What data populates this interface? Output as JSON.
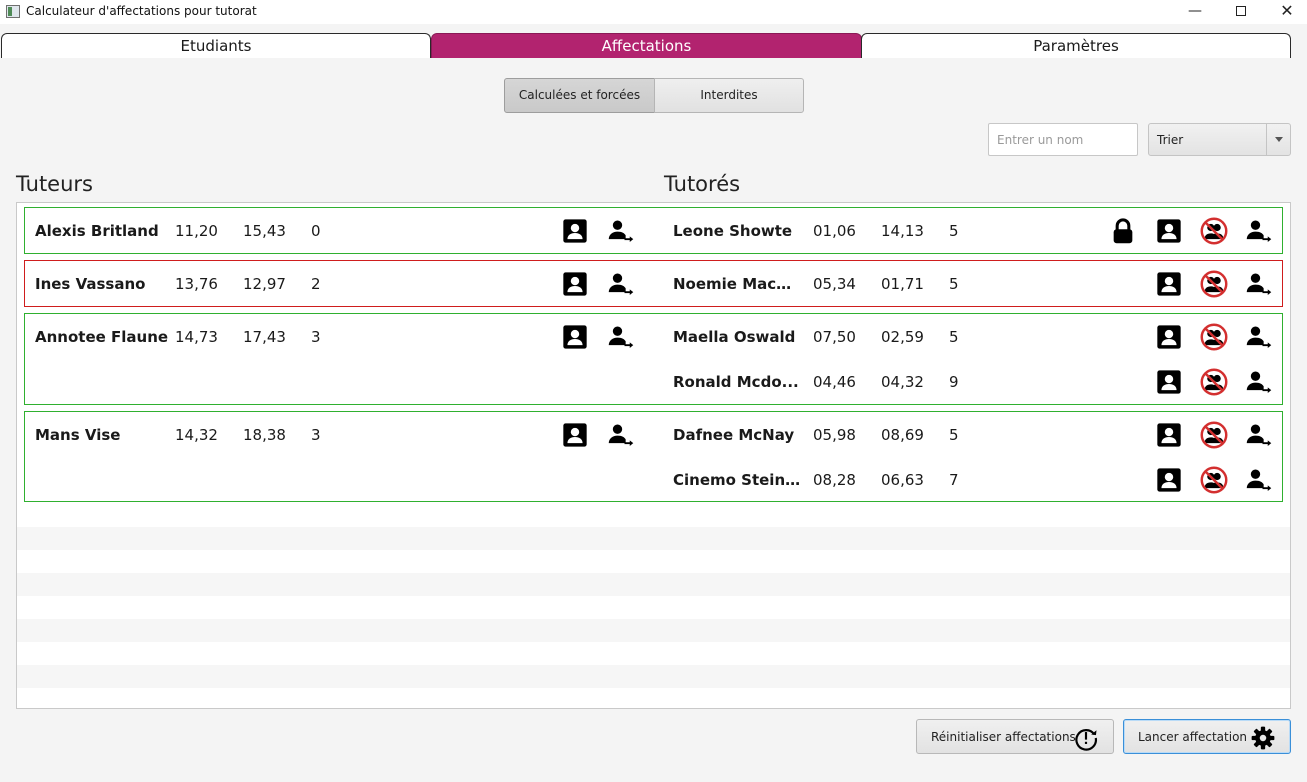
{
  "window": {
    "title": "Calculateur d'affectations pour tutorat"
  },
  "tabs": [
    {
      "label": "Etudiants"
    },
    {
      "label": "Affectations"
    },
    {
      "label": "Paramètres"
    }
  ],
  "subtabs": [
    {
      "label": "Calculées et forcées"
    },
    {
      "label": "Interdites"
    }
  ],
  "search": {
    "placeholder": "Entrer un nom",
    "value": ""
  },
  "sort": {
    "selected": "Trier"
  },
  "headings": {
    "tutors": "Tuteurs",
    "tutored": "Tutorés"
  },
  "colors": {
    "accent": "#b2236f",
    "ok_border": "#2fb02f",
    "error_border": "#cf1d1d",
    "forbid": "#d32f2f"
  },
  "groups": [
    {
      "status": "ok",
      "tutor": {
        "name": "Alexis Britland",
        "v1": "11,20",
        "v2": "15,43",
        "v3": "0"
      },
      "tutored": [
        {
          "name": "Leone Showte",
          "v1": "01,06",
          "v2": "14,13",
          "v3": "5",
          "locked": true
        }
      ]
    },
    {
      "status": "error",
      "tutor": {
        "name": "Ines Vassano",
        "v1": "13,76",
        "v2": "12,97",
        "v3": "2"
      },
      "tutored": [
        {
          "name": "Noemie Mack...",
          "v1": "05,34",
          "v2": "01,71",
          "v3": "5",
          "locked": false
        }
      ]
    },
    {
      "status": "ok",
      "tutor": {
        "name": "Annotee Flaune",
        "v1": "14,73",
        "v2": "17,43",
        "v3": "3"
      },
      "tutored": [
        {
          "name": "Maella Oswald",
          "v1": "07,50",
          "v2": "02,59",
          "v3": "5",
          "locked": false
        },
        {
          "name": "Ronald Mcdo...",
          "v1": "04,46",
          "v2": "04,32",
          "v3": "9",
          "locked": false
        }
      ]
    },
    {
      "status": "ok",
      "tutor": {
        "name": "Mans Vise",
        "v1": "14,32",
        "v2": "18,38",
        "v3": "3"
      },
      "tutored": [
        {
          "name": "Dafnee McNay",
          "v1": "05,98",
          "v2": "08,69",
          "v3": "5",
          "locked": false
        },
        {
          "name": "Cinemo Steiner",
          "v1": "08,28",
          "v2": "06,63",
          "v3": "7",
          "locked": false
        }
      ]
    }
  ],
  "actions": {
    "reset_label": "Réinitialiser affectations",
    "run_label": "Lancer affectation"
  },
  "icons": {
    "profile": "profile-card-icon",
    "move": "person-move-icon",
    "lock": "lock-icon",
    "forbid": "forbid-pair-icon",
    "reset": "reset-clock-icon",
    "run": "gear-icon"
  }
}
